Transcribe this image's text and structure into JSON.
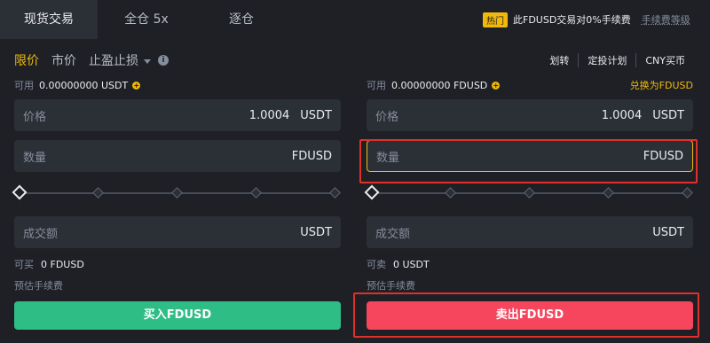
{
  "tabs": {
    "spot": "现货交易",
    "cross": "全仓 5x",
    "isolated": "逐仓"
  },
  "promo": {
    "badge": "热门",
    "text": "此FDUSD交易对0%手续费",
    "fee_level": "手续费等级"
  },
  "order_types": {
    "limit": "限价",
    "market": "市价",
    "stop": "止盈止损"
  },
  "top_links": {
    "transfer": "划转",
    "auto_invest": "定投计划",
    "cny_buy": "CNY买币"
  },
  "buy": {
    "avail_label": "可用",
    "avail_value": "0.00000000 USDT",
    "price_label": "价格",
    "price_value": "1.0004",
    "price_unit": "USDT",
    "amount_label": "数量",
    "amount_unit": "FDUSD",
    "total_label": "成交额",
    "total_unit": "USDT",
    "max_label": "可买",
    "max_value": "0 FDUSD",
    "fee_label": "预估手续费",
    "button": "买入FDUSD"
  },
  "sell": {
    "avail_label": "可用",
    "avail_value": "0.00000000 FDUSD",
    "convert": "兑换为FDUSD",
    "price_label": "价格",
    "price_value": "1.0004",
    "price_unit": "USDT",
    "amount_label": "数量",
    "amount_unit": "FDUSD",
    "total_label": "成交额",
    "total_unit": "USDT",
    "max_label": "可卖",
    "max_value": "0 USDT",
    "fee_label": "预估手续费",
    "button": "卖出FDUSD"
  },
  "colors": {
    "accent": "#f0b90b",
    "buy": "#2ebd85",
    "sell": "#f6465d",
    "annotation": "#e0302c"
  }
}
